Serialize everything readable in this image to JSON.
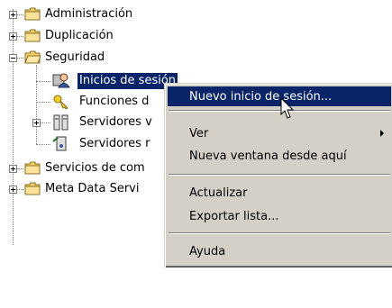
{
  "tree": {
    "items": [
      {
        "label": "Administración",
        "icon": "folder-icon",
        "expander": "plus"
      },
      {
        "label": "Duplicación",
        "icon": "folder-icon",
        "expander": "plus"
      },
      {
        "label": "Seguridad",
        "icon": "folder-open-icon",
        "expander": "minus"
      },
      {
        "label": "Inicios de sesión",
        "icon": "logins-icon",
        "selected": true
      },
      {
        "label": "Funciones d",
        "icon": "key-icon"
      },
      {
        "label": "Servidores v",
        "icon": "linked-servers-icon",
        "expander": "plus"
      },
      {
        "label": "Servidores r",
        "icon": "remote-servers-icon"
      },
      {
        "label": "Servicios de com",
        "icon": "folder-icon",
        "expander": "plus"
      },
      {
        "label": "Meta Data Servi",
        "icon": "folder-icon",
        "expander": "plus"
      }
    ]
  },
  "context_menu": {
    "items": [
      {
        "label": "Nuevo inicio de sesión...",
        "highlighted": true
      },
      {
        "label": "Ver",
        "has_submenu": true
      },
      {
        "label": "Nueva ventana desde aquí"
      },
      {
        "label": "Actualizar"
      },
      {
        "label": "Exportar lista..."
      },
      {
        "label": "Ayuda"
      }
    ]
  },
  "colors": {
    "selection": "#0a246a",
    "menu_bg": "#d4d0c8",
    "folder": "#f7d36b"
  }
}
